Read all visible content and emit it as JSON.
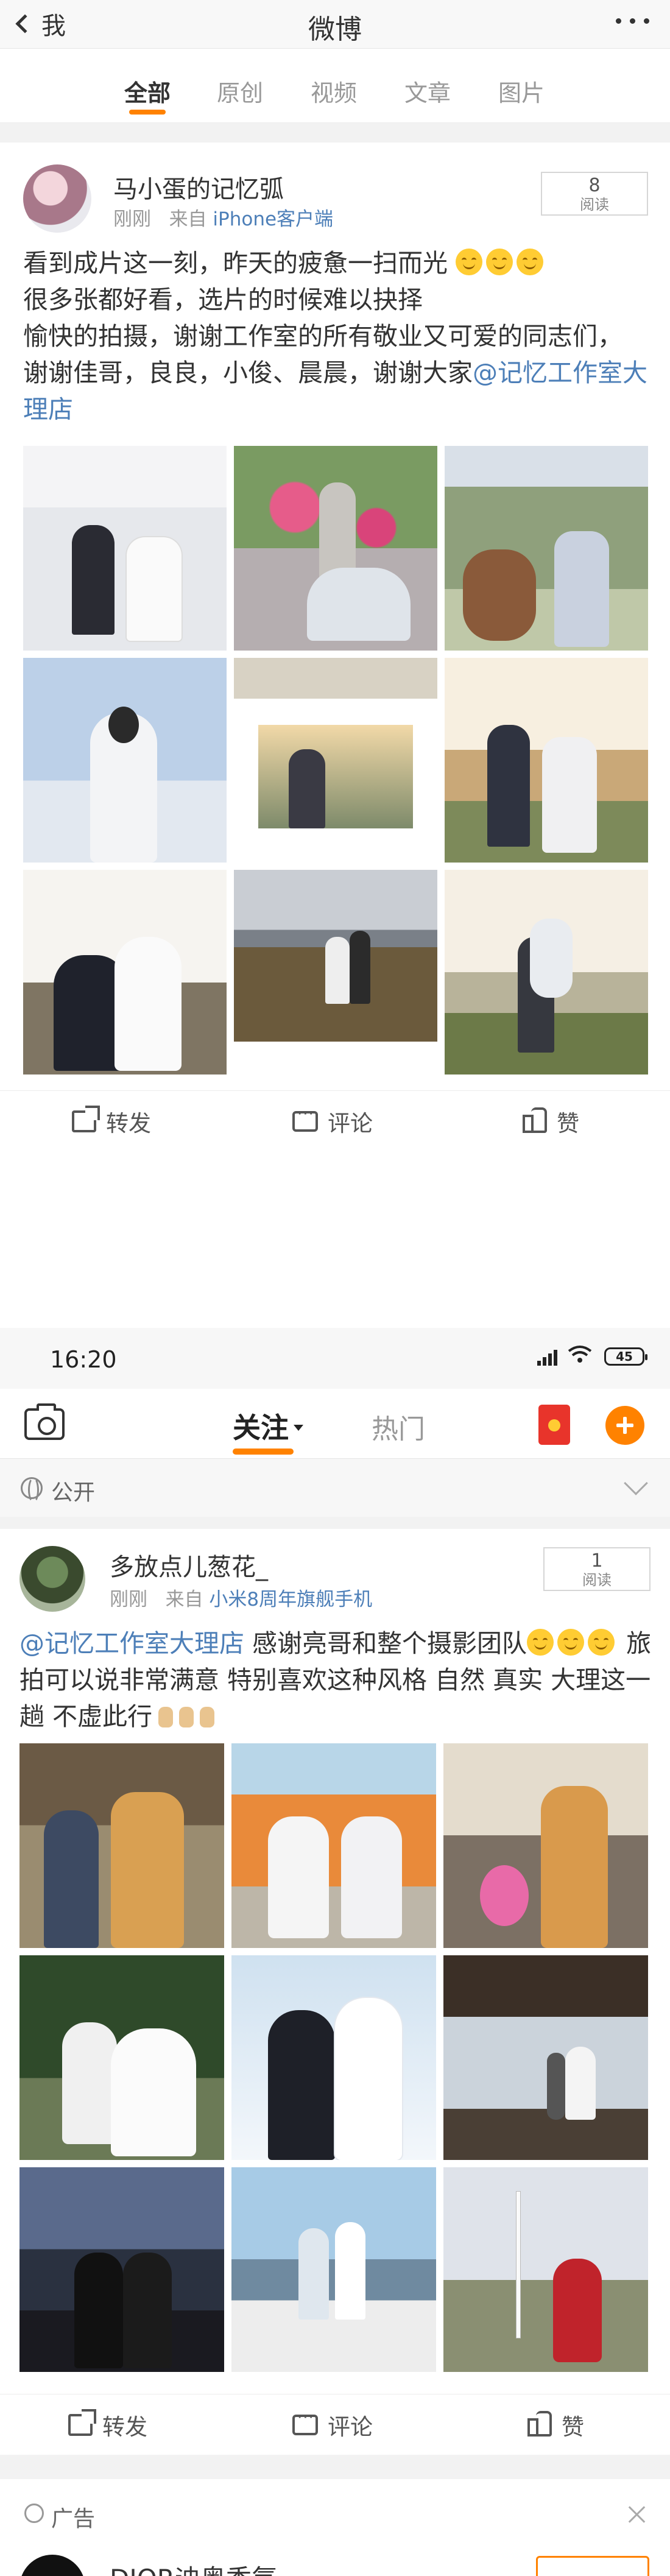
{
  "screen1": {
    "nav": {
      "back_label": "我",
      "title": "微博"
    },
    "tabs": [
      "全部",
      "原创",
      "视频",
      "文章",
      "图片"
    ],
    "active_tab": "全部",
    "post": {
      "username": "马小蛋的记忆弧",
      "time": "刚刚",
      "source_prefix": "来自",
      "source": "iPhone客户端",
      "read_count": "8",
      "read_label": "阅读",
      "text_line1": "看到成片这一刻，昨天的疲惫一扫而光",
      "text_line2": "很多张都好看，选片的时候难以抉择",
      "text_line3": "愉快的拍摄，谢谢工作室的所有敬业又可爱的同志们，",
      "text_line4_a": "谢谢佳哥，良良，小俊、晨晨，谢谢大家",
      "text_mention": "@记忆工作室大理店",
      "actions": {
        "repost": "转发",
        "comment": "评论",
        "like": "赞"
      }
    }
  },
  "screen2": {
    "status": {
      "time": "16:20",
      "battery": "45"
    },
    "nav": {
      "follow_tab": "关注",
      "hot_tab": "热门"
    },
    "visibility_label": "公开",
    "post": {
      "username": "多放点儿葱花_",
      "time": "刚刚",
      "source_prefix": "来自",
      "source": "小米8周年旗舰手机",
      "read_count": "1",
      "read_label": "阅读",
      "mention": "@记忆工作室大理店",
      "text_a": " 感谢亮哥和整个摄影团队",
      "text_b": " 旅拍可以说非常满意 特别喜欢这种风格 自然 真实 大理这一趟 不虚此行",
      "actions": {
        "repost": "转发",
        "comment": "评论",
        "like": "赞"
      }
    },
    "ad": {
      "label": "广告",
      "name": "DIOR迪奥香氛"
    }
  },
  "colors": {
    "accent": "#ff8200",
    "link": "#4d7fb8",
    "text": "#333333",
    "meta": "#999999",
    "separator": "#f2f2f2"
  }
}
